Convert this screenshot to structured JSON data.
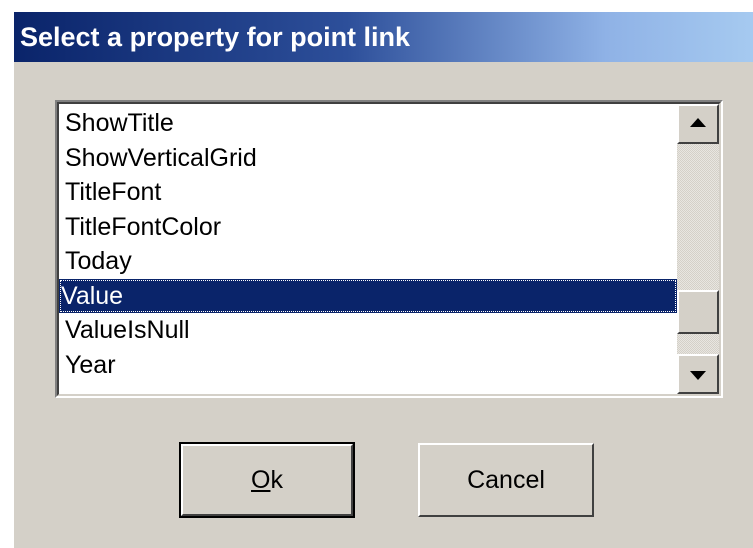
{
  "dialog": {
    "title": "Select a property for point link"
  },
  "listbox": {
    "items": [
      {
        "label": "ShowTitle",
        "selected": false
      },
      {
        "label": "ShowVerticalGrid",
        "selected": false
      },
      {
        "label": "TitleFont",
        "selected": false
      },
      {
        "label": "TitleFontColor",
        "selected": false
      },
      {
        "label": "Today",
        "selected": false
      },
      {
        "label": "Value",
        "selected": true
      },
      {
        "label": "ValueIsNull",
        "selected": false
      },
      {
        "label": "Year",
        "selected": false
      }
    ],
    "scroll_up_icon": "arrow-up-icon",
    "scroll_down_icon": "arrow-down-icon"
  },
  "buttons": {
    "ok_accel": "O",
    "ok_rest": "k",
    "cancel_label": "Cancel"
  },
  "colors": {
    "title_bar_start": "#0a246a",
    "title_bar_end": "#a6caf0",
    "selection": "#0a246a",
    "face": "#d4d0c8"
  }
}
